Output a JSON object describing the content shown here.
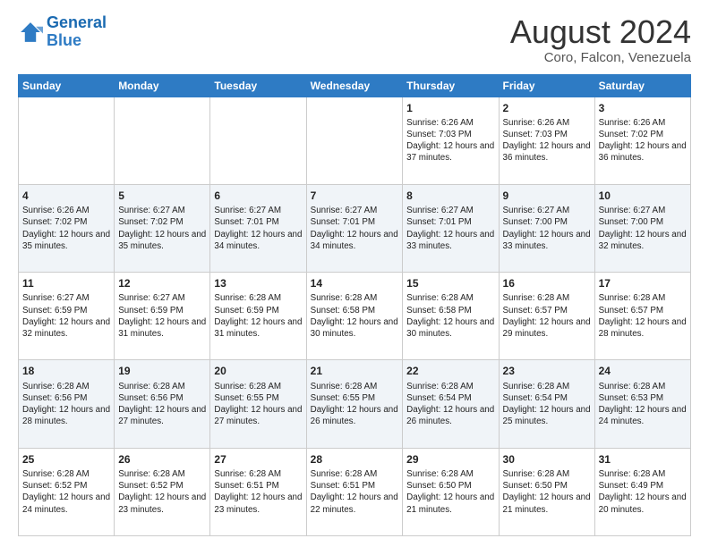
{
  "header": {
    "logo_line1": "General",
    "logo_line2": "Blue",
    "main_title": "August 2024",
    "subtitle": "Coro, Falcon, Venezuela"
  },
  "days_of_week": [
    "Sunday",
    "Monday",
    "Tuesday",
    "Wednesday",
    "Thursday",
    "Friday",
    "Saturday"
  ],
  "weeks": [
    [
      {
        "day": "",
        "info": ""
      },
      {
        "day": "",
        "info": ""
      },
      {
        "day": "",
        "info": ""
      },
      {
        "day": "",
        "info": ""
      },
      {
        "day": "1",
        "info": "Sunrise: 6:26 AM\nSunset: 7:03 PM\nDaylight: 12 hours and 37 minutes."
      },
      {
        "day": "2",
        "info": "Sunrise: 6:26 AM\nSunset: 7:03 PM\nDaylight: 12 hours and 36 minutes."
      },
      {
        "day": "3",
        "info": "Sunrise: 6:26 AM\nSunset: 7:02 PM\nDaylight: 12 hours and 36 minutes."
      }
    ],
    [
      {
        "day": "4",
        "info": "Sunrise: 6:26 AM\nSunset: 7:02 PM\nDaylight: 12 hours and 35 minutes."
      },
      {
        "day": "5",
        "info": "Sunrise: 6:27 AM\nSunset: 7:02 PM\nDaylight: 12 hours and 35 minutes."
      },
      {
        "day": "6",
        "info": "Sunrise: 6:27 AM\nSunset: 7:01 PM\nDaylight: 12 hours and 34 minutes."
      },
      {
        "day": "7",
        "info": "Sunrise: 6:27 AM\nSunset: 7:01 PM\nDaylight: 12 hours and 34 minutes."
      },
      {
        "day": "8",
        "info": "Sunrise: 6:27 AM\nSunset: 7:01 PM\nDaylight: 12 hours and 33 minutes."
      },
      {
        "day": "9",
        "info": "Sunrise: 6:27 AM\nSunset: 7:00 PM\nDaylight: 12 hours and 33 minutes."
      },
      {
        "day": "10",
        "info": "Sunrise: 6:27 AM\nSunset: 7:00 PM\nDaylight: 12 hours and 32 minutes."
      }
    ],
    [
      {
        "day": "11",
        "info": "Sunrise: 6:27 AM\nSunset: 6:59 PM\nDaylight: 12 hours and 32 minutes."
      },
      {
        "day": "12",
        "info": "Sunrise: 6:27 AM\nSunset: 6:59 PM\nDaylight: 12 hours and 31 minutes."
      },
      {
        "day": "13",
        "info": "Sunrise: 6:28 AM\nSunset: 6:59 PM\nDaylight: 12 hours and 31 minutes."
      },
      {
        "day": "14",
        "info": "Sunrise: 6:28 AM\nSunset: 6:58 PM\nDaylight: 12 hours and 30 minutes."
      },
      {
        "day": "15",
        "info": "Sunrise: 6:28 AM\nSunset: 6:58 PM\nDaylight: 12 hours and 30 minutes."
      },
      {
        "day": "16",
        "info": "Sunrise: 6:28 AM\nSunset: 6:57 PM\nDaylight: 12 hours and 29 minutes."
      },
      {
        "day": "17",
        "info": "Sunrise: 6:28 AM\nSunset: 6:57 PM\nDaylight: 12 hours and 28 minutes."
      }
    ],
    [
      {
        "day": "18",
        "info": "Sunrise: 6:28 AM\nSunset: 6:56 PM\nDaylight: 12 hours and 28 minutes."
      },
      {
        "day": "19",
        "info": "Sunrise: 6:28 AM\nSunset: 6:56 PM\nDaylight: 12 hours and 27 minutes."
      },
      {
        "day": "20",
        "info": "Sunrise: 6:28 AM\nSunset: 6:55 PM\nDaylight: 12 hours and 27 minutes."
      },
      {
        "day": "21",
        "info": "Sunrise: 6:28 AM\nSunset: 6:55 PM\nDaylight: 12 hours and 26 minutes."
      },
      {
        "day": "22",
        "info": "Sunrise: 6:28 AM\nSunset: 6:54 PM\nDaylight: 12 hours and 26 minutes."
      },
      {
        "day": "23",
        "info": "Sunrise: 6:28 AM\nSunset: 6:54 PM\nDaylight: 12 hours and 25 minutes."
      },
      {
        "day": "24",
        "info": "Sunrise: 6:28 AM\nSunset: 6:53 PM\nDaylight: 12 hours and 24 minutes."
      }
    ],
    [
      {
        "day": "25",
        "info": "Sunrise: 6:28 AM\nSunset: 6:52 PM\nDaylight: 12 hours and 24 minutes."
      },
      {
        "day": "26",
        "info": "Sunrise: 6:28 AM\nSunset: 6:52 PM\nDaylight: 12 hours and 23 minutes."
      },
      {
        "day": "27",
        "info": "Sunrise: 6:28 AM\nSunset: 6:51 PM\nDaylight: 12 hours and 23 minutes."
      },
      {
        "day": "28",
        "info": "Sunrise: 6:28 AM\nSunset: 6:51 PM\nDaylight: 12 hours and 22 minutes."
      },
      {
        "day": "29",
        "info": "Sunrise: 6:28 AM\nSunset: 6:50 PM\nDaylight: 12 hours and 21 minutes."
      },
      {
        "day": "30",
        "info": "Sunrise: 6:28 AM\nSunset: 6:50 PM\nDaylight: 12 hours and 21 minutes."
      },
      {
        "day": "31",
        "info": "Sunrise: 6:28 AM\nSunset: 6:49 PM\nDaylight: 12 hours and 20 minutes."
      }
    ]
  ]
}
